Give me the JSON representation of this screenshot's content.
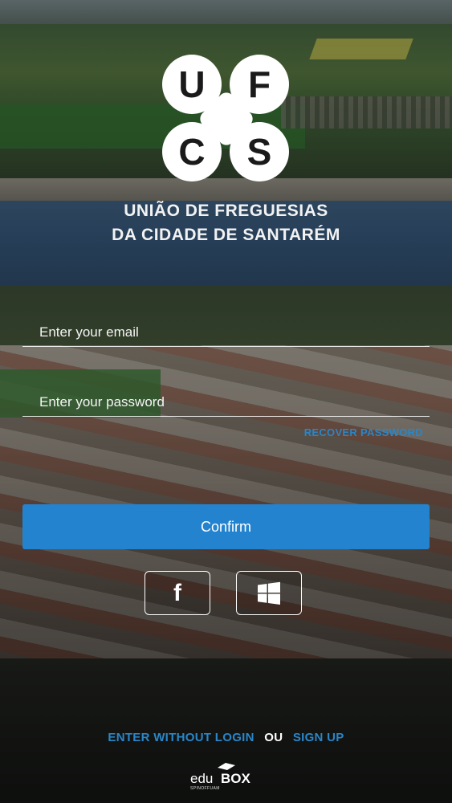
{
  "logo": {
    "letters": [
      "U",
      "F",
      "C",
      "S"
    ]
  },
  "title": {
    "line1": "UNIÃO DE FREGUESIAS",
    "line2": "DA CIDADE DE SANTARÉM"
  },
  "form": {
    "email_placeholder": "Enter your email",
    "password_placeholder": "Enter your password",
    "recover_label": "RECOVER PASSWORD",
    "confirm_label": "Confirm"
  },
  "social": {
    "facebook_glyph": "f"
  },
  "footer": {
    "enter_without_login": "ENTER WITHOUT LOGIN",
    "or": "OU",
    "sign_up": "SIGN UP",
    "brand_edu": "edu",
    "brand_box": "BOX",
    "brand_sub": "SPINOFFUAM"
  },
  "colors": {
    "accent": "#2483cf",
    "link": "#2a86c8"
  }
}
